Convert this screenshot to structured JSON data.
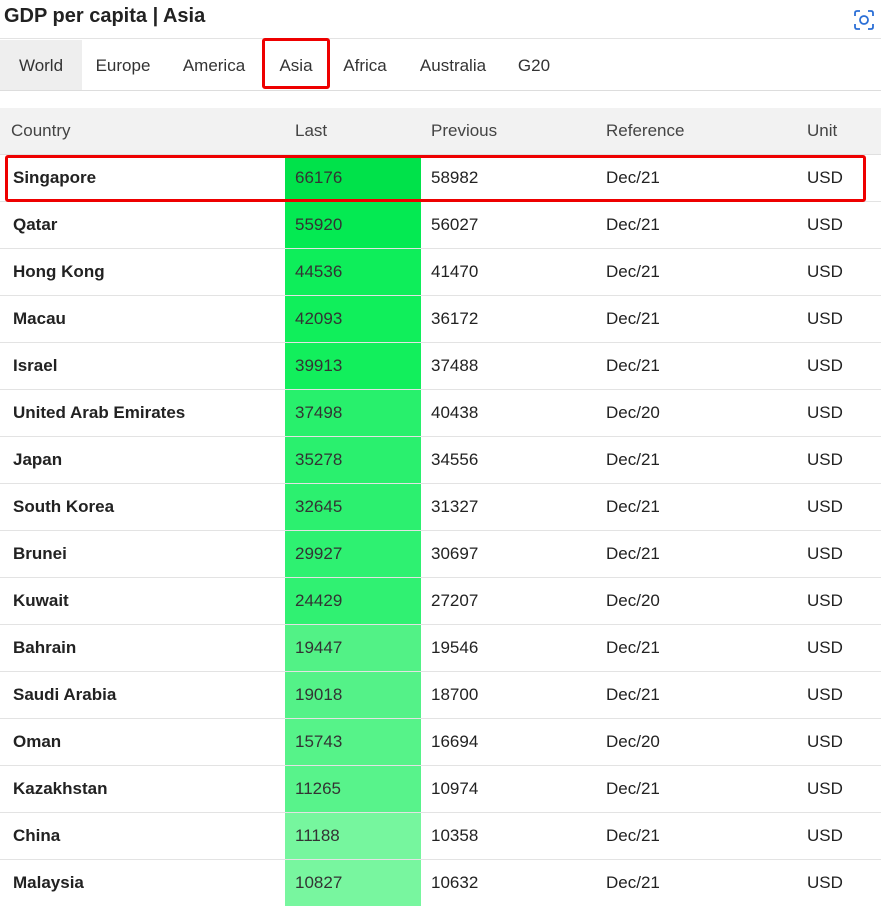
{
  "header": {
    "title": "GDP per capita | Asia",
    "scan_icon": "scan-icon"
  },
  "tabs": [
    {
      "label": "World",
      "selected": false
    },
    {
      "label": "Europe",
      "selected": false
    },
    {
      "label": "America",
      "selected": false
    },
    {
      "label": "Asia",
      "selected": true
    },
    {
      "label": "Africa",
      "selected": false
    },
    {
      "label": "Australia",
      "selected": false
    },
    {
      "label": "G20",
      "selected": false
    }
  ],
  "table": {
    "headers": [
      "Country",
      "Last",
      "Previous",
      "Reference",
      "Unit"
    ],
    "rows": [
      {
        "country": "Singapore",
        "last": "66176",
        "previous": "58982",
        "reference": "Dec/21",
        "unit": "USD",
        "color": "#00e24a"
      },
      {
        "country": "Qatar",
        "last": "55920",
        "previous": "56027",
        "reference": "Dec/21",
        "unit": "USD",
        "color": "#04ea52"
      },
      {
        "country": "Hong Kong",
        "last": "44536",
        "previous": "41470",
        "reference": "Dec/21",
        "unit": "USD",
        "color": "#0eee5a"
      },
      {
        "country": "Macau",
        "last": "42093",
        "previous": "36172",
        "reference": "Dec/21",
        "unit": "USD",
        "color": "#10ef5b"
      },
      {
        "country": "Israel",
        "last": "39913",
        "previous": "37488",
        "reference": "Dec/21",
        "unit": "USD",
        "color": "#12ef5c"
      },
      {
        "country": "United Arab Emirates",
        "last": "37498",
        "previous": "40438",
        "reference": "Dec/20",
        "unit": "USD",
        "color": "#28f06c"
      },
      {
        "country": "Japan",
        "last": "35278",
        "previous": "34556",
        "reference": "Dec/21",
        "unit": "USD",
        "color": "#2af06e"
      },
      {
        "country": "South Korea",
        "last": "32645",
        "previous": "31327",
        "reference": "Dec/21",
        "unit": "USD",
        "color": "#2cf06f"
      },
      {
        "country": "Brunei",
        "last": "29927",
        "previous": "30697",
        "reference": "Dec/21",
        "unit": "USD",
        "color": "#2ef171"
      },
      {
        "country": "Kuwait",
        "last": "24429",
        "previous": "27207",
        "reference": "Dec/20",
        "unit": "USD",
        "color": "#30f172"
      },
      {
        "country": "Bahrain",
        "last": "19447",
        "previous": "19546",
        "reference": "Dec/21",
        "unit": "USD",
        "color": "#52f286"
      },
      {
        "country": "Saudi Arabia",
        "last": "19018",
        "previous": "18700",
        "reference": "Dec/21",
        "unit": "USD",
        "color": "#54f288"
      },
      {
        "country": "Oman",
        "last": "15743",
        "previous": "16694",
        "reference": "Dec/20",
        "unit": "USD",
        "color": "#56f389"
      },
      {
        "country": "Kazakhstan",
        "last": "11265",
        "previous": "10974",
        "reference": "Dec/21",
        "unit": "USD",
        "color": "#58f38b"
      },
      {
        "country": "China",
        "last": "11188",
        "previous": "10358",
        "reference": "Dec/21",
        "unit": "USD",
        "color": "#76f69e"
      },
      {
        "country": "Malaysia",
        "last": "10827",
        "previous": "10632",
        "reference": "Dec/21",
        "unit": "USD",
        "color": "#78f69f"
      }
    ]
  },
  "highlight_color": "#ee0000"
}
